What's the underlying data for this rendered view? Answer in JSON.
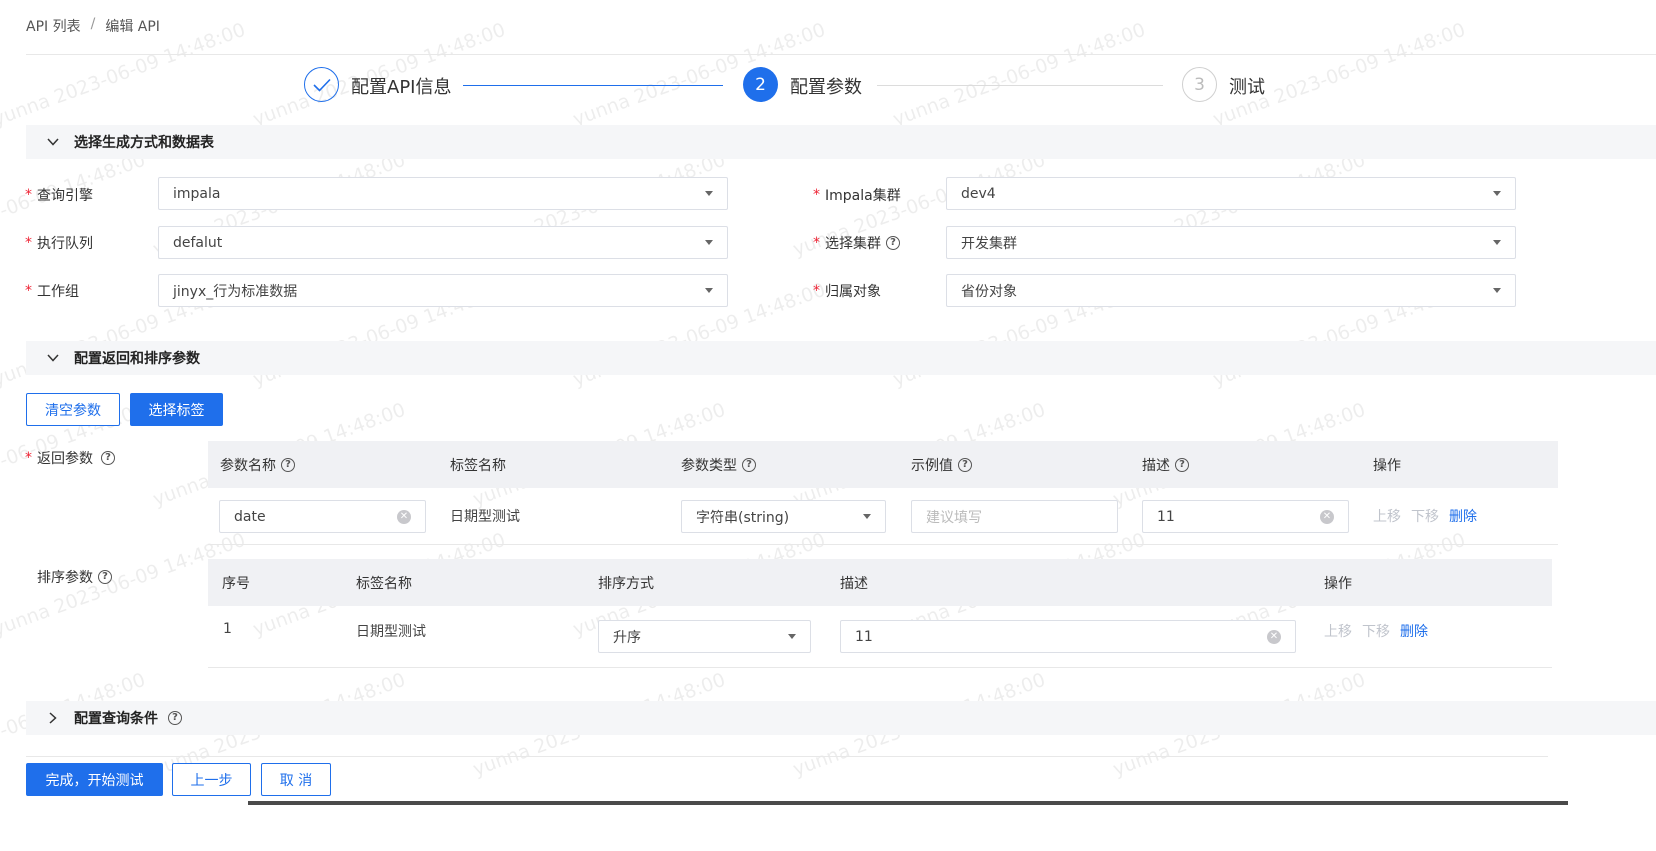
{
  "breadcrumb": {
    "root": "API 列表",
    "separator": "/",
    "current": "编辑 API"
  },
  "steps": [
    {
      "num": "✓",
      "label": "配置API信息",
      "state": "done"
    },
    {
      "num": "2",
      "label": "配置参数",
      "state": "active"
    },
    {
      "num": "3",
      "label": "测试",
      "state": "wait"
    }
  ],
  "section1": {
    "title": "选择生成方式和数据表"
  },
  "form": {
    "engine": {
      "label": "查询引擎",
      "value": "impala"
    },
    "cluster": {
      "label": "Impala集群",
      "value": "dev4"
    },
    "queue": {
      "label": "执行队列",
      "value": "defalut"
    },
    "select_cluster": {
      "label": "选择集群",
      "value": "开发集群"
    },
    "workgroup": {
      "label": "工作组",
      "value": "jinyx_行为标准数据"
    },
    "owner": {
      "label": "归属对象",
      "value": "省份对象"
    }
  },
  "section2": {
    "title": "配置返回和排序参数"
  },
  "buttons": {
    "clear": "清空参数",
    "select_tags": "选择标签"
  },
  "return_params": {
    "label": "返回参数",
    "headers": {
      "name": "参数名称",
      "tag": "标签名称",
      "type": "参数类型",
      "example": "示例值",
      "desc": "描述",
      "ops": "操作"
    },
    "row": {
      "name": "date",
      "tag": "日期型测试",
      "type": "字符串(string)",
      "example_placeholder": "建议填写",
      "desc": "11"
    }
  },
  "sort_params": {
    "label": "排序参数",
    "headers": {
      "index": "序号",
      "tag": "标签名称",
      "order": "排序方式",
      "desc": "描述",
      "ops": "操作"
    },
    "row": {
      "index": "1",
      "tag": "日期型测试",
      "order": "升序",
      "desc": "11"
    }
  },
  "ops": {
    "up": "上移",
    "down": "下移",
    "delete": "删除"
  },
  "section3": {
    "title": "配置查询条件"
  },
  "footer": {
    "finish": "完成，开始测试",
    "prev": "上一步",
    "cancel": "取 消"
  },
  "watermark": "yunna 2023-06-09 14:48:00",
  "colors": {
    "primary": "#1f6feb",
    "required": "#e23333",
    "section_bg": "#f5f6f8"
  }
}
